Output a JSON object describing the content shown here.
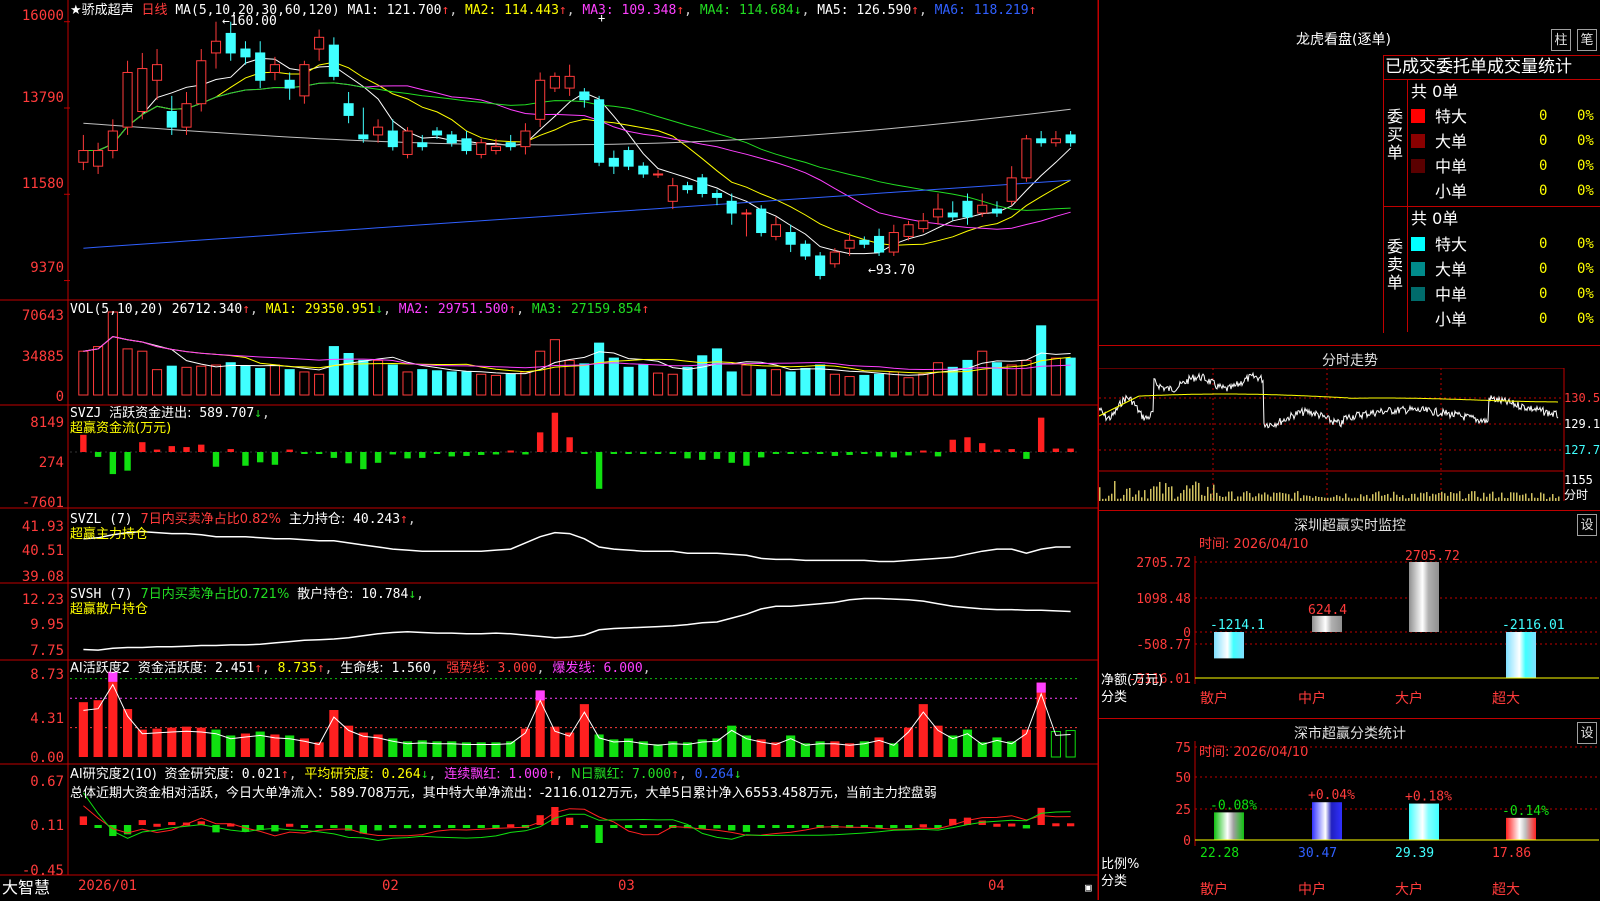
{
  "app": {
    "brand": "大智慧"
  },
  "chart_data": {
    "type": "candlestick",
    "title": "骄成超声",
    "period": "日线",
    "price_axis": {
      "ticks": [
        16000,
        13790,
        11580,
        9370
      ],
      "ylim": [
        9000,
        16300
      ]
    },
    "x_labels": [
      "2026/01",
      "02",
      "03",
      "04"
    ],
    "annotations": {
      "high": "160.00",
      "low": "93.70"
    },
    "ma_line": {
      "label": "MA(5,10,20,30,60,120)",
      "ma1": "121.700",
      "ma2": "114.443",
      "ma3": "109.348",
      "ma4": "114.684",
      "ma5": "126.590",
      "ma6": "118.219"
    },
    "ma_colors": [
      "#ffffff",
      "#ffff00",
      "#ff40ff",
      "#22dd22",
      "#c0c0c0",
      "#3060ff"
    ],
    "candles": [
      [
        12400,
        12700,
        12200,
        13100
      ],
      [
        12300,
        12700,
        12100,
        12900
      ],
      [
        12700,
        13200,
        12500,
        13500
      ],
      [
        13300,
        14700,
        13100,
        15000
      ],
      [
        13700,
        14800,
        13500,
        15200
      ],
      [
        14500,
        14900,
        14000,
        15300
      ],
      [
        13700,
        13300,
        13100,
        14100
      ],
      [
        13300,
        13900,
        13100,
        14200
      ],
      [
        13900,
        15000,
        13700,
        15300
      ],
      [
        15200,
        15500,
        14800,
        16000
      ],
      [
        15700,
        15200,
        15000,
        16000
      ],
      [
        15300,
        15100,
        14900,
        15500
      ],
      [
        15200,
        14500,
        14300,
        15500
      ],
      [
        14700,
        14900,
        14500,
        15100
      ],
      [
        14500,
        14300,
        14000,
        14700
      ],
      [
        14100,
        14900,
        13900,
        15000
      ],
      [
        15300,
        15600,
        15000,
        15800
      ],
      [
        15400,
        14600,
        14500,
        15600
      ],
      [
        13900,
        13600,
        13400,
        14200
      ],
      [
        13100,
        13000,
        12900,
        13800
      ],
      [
        13100,
        13300,
        12900,
        13500
      ],
      [
        13200,
        12800,
        12700,
        13500
      ],
      [
        12600,
        13200,
        12500,
        13300
      ],
      [
        12900,
        12800,
        12700,
        13100
      ],
      [
        13200,
        13100,
        13000,
        13300
      ],
      [
        13100,
        12900,
        12800,
        13200
      ],
      [
        13000,
        12700,
        12600,
        13200
      ],
      [
        12600,
        12900,
        12500,
        13000
      ],
      [
        12700,
        12800,
        12600,
        13000
      ],
      [
        12900,
        12800,
        12700,
        13100
      ],
      [
        12800,
        13200,
        12600,
        13400
      ],
      [
        13500,
        14500,
        13300,
        14700
      ],
      [
        14300,
        14600,
        14200,
        14700
      ],
      [
        14300,
        14600,
        14100,
        14900
      ],
      [
        14200,
        14000,
        13800,
        14300
      ],
      [
        14000,
        12400,
        12300,
        14100
      ],
      [
        12500,
        12300,
        12100,
        12700
      ],
      [
        12700,
        12300,
        12200,
        12800
      ],
      [
        12300,
        12100,
        12000,
        12400
      ],
      [
        12100,
        12100,
        12000,
        12200
      ],
      [
        11400,
        11800,
        11200,
        12000
      ],
      [
        11800,
        11700,
        11600,
        11900
      ],
      [
        12000,
        11600,
        11500,
        12100
      ],
      [
        11600,
        11500,
        11300,
        11700
      ],
      [
        11400,
        11100,
        10800,
        11600
      ],
      [
        11100,
        11100,
        10500,
        11200
      ],
      [
        11200,
        10600,
        10500,
        11300
      ],
      [
        10500,
        10800,
        10400,
        11000
      ],
      [
        10600,
        10300,
        10100,
        10800
      ],
      [
        10300,
        10000,
        9900,
        10400
      ],
      [
        10000,
        9500,
        9400,
        10100
      ],
      [
        9800,
        10100,
        9700,
        10200
      ],
      [
        10200,
        10400,
        10000,
        10600
      ],
      [
        10400,
        10300,
        10200,
        10500
      ],
      [
        10500,
        10100,
        10000,
        10700
      ],
      [
        10100,
        10600,
        10000,
        10800
      ],
      [
        10500,
        10800,
        10400,
        10900
      ],
      [
        10700,
        10900,
        10600,
        11100
      ],
      [
        11000,
        11200,
        10800,
        11600
      ],
      [
        11100,
        11000,
        10900,
        11400
      ],
      [
        11400,
        11000,
        10800,
        11600
      ],
      [
        11100,
        11300,
        11000,
        11600
      ],
      [
        11200,
        11100,
        11000,
        11400
      ],
      [
        11400,
        12000,
        11300,
        12300
      ],
      [
        12000,
        13000,
        11900,
        13100
      ],
      [
        13000,
        12900,
        12800,
        13200
      ],
      [
        12900,
        13000,
        12800,
        13200
      ],
      [
        13100,
        12900,
        12800,
        13200
      ]
    ],
    "volume": {
      "label": "VOL(5,10,20)",
      "value": "26712.340",
      "ma1": "29350.951",
      "ma2": "29751.500",
      "ma3": "27159.854",
      "ticks": [
        "70643",
        "34885",
        "0"
      ],
      "max": 72000,
      "values": [
        38000,
        42000,
        72000,
        40000,
        38000,
        22000,
        25000,
        24000,
        25000,
        26000,
        28000,
        25000,
        23000,
        26000,
        22000,
        20000,
        18000,
        42000,
        36000,
        30000,
        30000,
        26000,
        20000,
        22000,
        21000,
        20000,
        20000,
        18000,
        17000,
        18000,
        20000,
        38000,
        48000,
        30000,
        27000,
        45000,
        32000,
        24000,
        26000,
        19000,
        18000,
        24000,
        34000,
        40000,
        20000,
        26000,
        22000,
        22000,
        20000,
        23000,
        26000,
        18000,
        16000,
        17000,
        18000,
        20000,
        15000,
        18000,
        28000,
        24000,
        30000,
        38000,
        28000,
        26000,
        30000,
        60000,
        32000,
        32000
      ]
    },
    "svzj": {
      "label": "SVZJ",
      "desc": "活跃资金进出:",
      "value": "589.707",
      "sub": "超赢资金流(万元)",
      "ticks": [
        "8149",
        "274",
        "-7601"
      ],
      "values": [
        3500,
        -1000,
        -4500,
        -3800,
        2000,
        500,
        1200,
        1000,
        1500,
        -3000,
        600,
        -2800,
        -2100,
        -2600,
        500,
        -300,
        -300,
        -1200,
        -2300,
        -3500,
        -2200,
        -500,
        -1300,
        -1200,
        -300,
        -900,
        -800,
        -600,
        -500,
        300,
        -500,
        4000,
        8000,
        3000,
        -300,
        -7500,
        -400,
        -300,
        -300,
        -200,
        -200,
        -1300,
        -1600,
        -1400,
        -2200,
        -2800,
        -1100,
        -200,
        -200,
        -200,
        -200,
        -800,
        -600,
        -400,
        -900,
        -1100,
        -700,
        300,
        -900,
        2500,
        3000,
        1800,
        500,
        600,
        -1400,
        7000,
        700,
        700
      ]
    },
    "svzl": {
      "label": "SVZL (7)",
      "desc": "7日内买卖净占比0.82%",
      "holding_label": "主力持仓:",
      "value": "40.243",
      "sub": "超赢主力持仓",
      "ticks": [
        "41.93",
        "40.51",
        "39.08"
      ],
      "ylim": [
        38.9,
        42.2
      ],
      "values": [
        40.9,
        40.95,
        41.1,
        41.2,
        41.25,
        41.2,
        41.15,
        41.15,
        41.1,
        41.0,
        41.0,
        41.0,
        40.95,
        40.9,
        40.9,
        40.85,
        40.8,
        40.8,
        40.7,
        40.6,
        40.5,
        40.4,
        40.35,
        40.3,
        40.3,
        40.3,
        40.3,
        40.3,
        40.35,
        40.4,
        40.7,
        41.0,
        41.2,
        41.15,
        40.9,
        40.5,
        40.4,
        40.35,
        40.3,
        40.3,
        40.3,
        40.2,
        40.2,
        40.2,
        40.15,
        40.1,
        39.95,
        39.9,
        39.9,
        39.85,
        39.85,
        39.85,
        39.85,
        39.85,
        39.8,
        39.8,
        39.85,
        39.9,
        39.95,
        40.0,
        40.15,
        40.3,
        40.4,
        40.4,
        40.2,
        40.4,
        40.5,
        40.5
      ]
    },
    "svsh": {
      "label": "SVSH (7)",
      "desc": "7日内买卖净占比0.721%",
      "holding_label": "散户持仓:",
      "value": "10.784",
      "sub": "超赢散户持仓",
      "ticks": [
        "12.23",
        "9.95",
        "7.75"
      ],
      "ylim": [
        7.4,
        12.6
      ],
      "values": [
        7.9,
        7.85,
        8.0,
        8.05,
        8.05,
        8.1,
        8.1,
        8.15,
        8.2,
        8.2,
        8.25,
        8.25,
        8.3,
        8.4,
        8.5,
        8.6,
        8.65,
        8.7,
        8.8,
        8.95,
        9.1,
        9.2,
        9.25,
        9.2,
        9.15,
        9.15,
        9.1,
        9.1,
        9.15,
        9.1,
        9.0,
        8.9,
        8.8,
        8.85,
        9.0,
        9.4,
        9.5,
        9.55,
        9.6,
        9.65,
        9.7,
        9.8,
        9.95,
        10.0,
        10.3,
        10.6,
        11.0,
        11.2,
        11.2,
        11.3,
        11.4,
        11.5,
        11.7,
        11.8,
        11.8,
        11.75,
        11.7,
        11.6,
        11.4,
        11.2,
        11.1,
        11.0,
        10.95,
        10.95,
        10.9,
        10.9,
        10.85,
        10.8
      ]
    },
    "ai_active": {
      "label": "AI活跃度2",
      "desc": "资金活跃度:",
      "v1": "2.451",
      "v2": "8.735",
      "life_label": "生命线:",
      "life": "1.560",
      "strong_label": "强势线:",
      "strong": "3.000",
      "burst_label": "爆发线:",
      "burst": "6.000",
      "ticks": [
        "8.73",
        "4.31",
        "0.00"
      ],
      "max": 9.5,
      "values": [
        5.6,
        5.8,
        8.7,
        4.9,
        2.8,
        2.9,
        3.0,
        3.1,
        3.0,
        2.8,
        2.2,
        2.4,
        2.6,
        2.3,
        2.2,
        1.9,
        1.5,
        4.8,
        3.2,
        2.5,
        2.3,
        1.9,
        1.6,
        1.7,
        1.6,
        1.6,
        1.5,
        1.5,
        1.5,
        1.6,
        2.9,
        6.8,
        3.1,
        2.5,
        5.4,
        2.3,
        1.8,
        1.9,
        1.6,
        1.3,
        1.6,
        1.5,
        1.8,
        1.9,
        3.2,
        2.2,
        1.8,
        1.5,
        2.2,
        1.4,
        1.6,
        1.6,
        1.4,
        1.6,
        2.0,
        1.4,
        3.0,
        5.4,
        3.2,
        2.2,
        2.8,
        1.5,
        2.0,
        1.6,
        2.8,
        7.6,
        2.6,
        2.7
      ],
      "colors": [
        "r",
        "r",
        "m",
        "r",
        "r",
        "r",
        "r",
        "r",
        "r",
        "g",
        "g",
        "r",
        "g",
        "r",
        "g",
        "r",
        "r",
        "r",
        "r",
        "r",
        "r",
        "g",
        "g",
        "g",
        "g",
        "g",
        "g",
        "g",
        "g",
        "g",
        "r",
        "m",
        "r",
        "r",
        "r",
        "g",
        "g",
        "g",
        "g",
        "g",
        "g",
        "g",
        "g",
        "g",
        "g",
        "g",
        "r",
        "r",
        "g",
        "g",
        "g",
        "r",
        "r",
        "g",
        "r",
        "g",
        "r",
        "r",
        "r",
        "g",
        "g",
        "g",
        "g",
        "g",
        "r",
        "m",
        "g",
        "g"
      ]
    },
    "ai_research": {
      "label": "AI研究度2(10)",
      "desc": "资金研究度:",
      "value": "0.021",
      "avg_label": "平均研究度:",
      "avg": "0.264",
      "cont_label": "连续飘红:",
      "cont": "1.000",
      "nday_label": "N日飘红:",
      "nday": "7.000",
      "v5": "0.264",
      "summary": "总体近期大资金相对活跃，今日大单净流入：589.708万元，其中特大单净流出：-2116.012万元，大单5日累计净入6553.458万元，当前主力控盘弱",
      "ticks": [
        "0.67",
        "0.11",
        "-0.45"
      ]
    }
  },
  "dragon_tiger": {
    "title": "龙虎看盘(逐单)",
    "tabs": [
      "柱",
      "笔"
    ],
    "header": "已成交委托单成交量统计",
    "buy_group_label": "委买单",
    "sell_group_label": "委卖单",
    "buy_total": "共 0单",
    "sell_total": "共 0单",
    "rows": [
      {
        "label": "特大",
        "count": "0",
        "pct": "0%"
      },
      {
        "label": "大单",
        "count": "0",
        "pct": "0%"
      },
      {
        "label": "中单",
        "count": "0",
        "pct": "0%"
      },
      {
        "label": "小单",
        "count": "0",
        "pct": "0%"
      }
    ],
    "buy_colors": [
      "#ff0000",
      "#8b0000",
      "#5a0000",
      "#000000"
    ],
    "sell_colors": [
      "#00ffff",
      "#008b8b",
      "#006b6b",
      "#000000"
    ]
  },
  "intraday": {
    "title": "分时走势",
    "ticks": [
      "130.5",
      "129.1",
      "127.7",
      "1155",
      "分时"
    ]
  },
  "sz_monitor": {
    "title": "深圳超赢实时监控",
    "settings": "设",
    "time": "时间: 2026/04/10",
    "ticks": [
      "2705.72",
      "1098.48",
      "0",
      "-508.77",
      "-2116.01"
    ],
    "ylabel": "净额(万元)",
    "xlabel": "分类",
    "categories": [
      "散户",
      "中户",
      "大户",
      "超大"
    ],
    "values": [
      -1214.1,
      624.4,
      2705.72,
      -2116.01
    ],
    "labels": [
      "-1214.1",
      "624.4",
      "2705.72",
      "-2116.01"
    ]
  },
  "sz_class": {
    "title": "深市超赢分类统计",
    "settings": "设",
    "time": "时间: 2026/04/10",
    "ticks": [
      "75",
      "50",
      "25",
      "0"
    ],
    "ylabel": "比例%",
    "xlabel": "分类",
    "categories": [
      "散户",
      "中户",
      "大户",
      "超大"
    ],
    "values": [
      22.28,
      30.47,
      29.39,
      17.86
    ],
    "changes": [
      "-0.08%",
      "+0.04%",
      "+0.18%",
      "-0.14%"
    ]
  }
}
